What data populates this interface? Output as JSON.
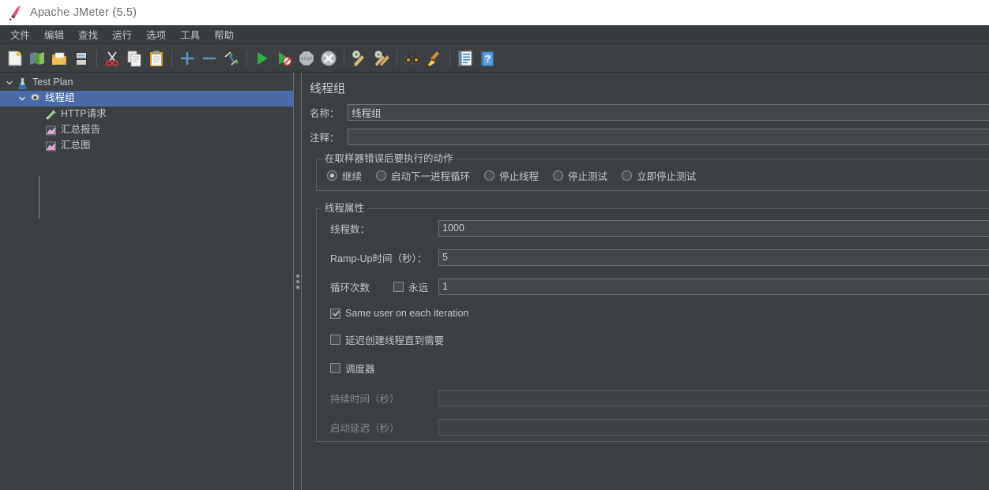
{
  "window": {
    "title": "Apache JMeter (5.5)",
    "logo_icon": "jmeter-feather-logo"
  },
  "menubar": {
    "items": [
      {
        "label": "文件",
        "name": "menu-file"
      },
      {
        "label": "编辑",
        "name": "menu-edit"
      },
      {
        "label": "查找",
        "name": "menu-search"
      },
      {
        "label": "运行",
        "name": "menu-run"
      },
      {
        "label": "选项",
        "name": "menu-options"
      },
      {
        "label": "工具",
        "name": "menu-tools"
      },
      {
        "label": "帮助",
        "name": "menu-help"
      }
    ]
  },
  "toolbar": {
    "buttons": [
      {
        "icon": "new-document-icon",
        "name": "new-test-plan-button"
      },
      {
        "icon": "templates-icon",
        "name": "templates-button"
      },
      {
        "icon": "open-folder-icon",
        "name": "open-button"
      },
      {
        "icon": "save-floppy-icon",
        "name": "save-button"
      },
      {
        "icon": "separator",
        "name": "toolbar-separator-1"
      },
      {
        "icon": "scissors-icon",
        "name": "cut-button"
      },
      {
        "icon": "copy-icon",
        "name": "copy-button"
      },
      {
        "icon": "paste-clipboard-icon",
        "name": "paste-button"
      },
      {
        "icon": "separator",
        "name": "toolbar-separator-2"
      },
      {
        "icon": "plus-icon",
        "name": "expand-all-button"
      },
      {
        "icon": "minus-icon",
        "name": "collapse-all-button"
      },
      {
        "icon": "toggle-icon",
        "name": "toggle-button"
      },
      {
        "icon": "separator",
        "name": "toolbar-separator-3"
      },
      {
        "icon": "play-green-icon",
        "name": "start-button"
      },
      {
        "icon": "play-no-timers-icon",
        "name": "start-no-pauses-button"
      },
      {
        "icon": "stop-sign-icon",
        "name": "stop-button"
      },
      {
        "icon": "shutdown-icon",
        "name": "shutdown-button"
      },
      {
        "icon": "separator",
        "name": "toolbar-separator-4"
      },
      {
        "icon": "clear-broom-icon",
        "name": "clear-button"
      },
      {
        "icon": "clear-all-broom-icon",
        "name": "clear-all-button"
      },
      {
        "icon": "separator",
        "name": "toolbar-separator-5"
      },
      {
        "icon": "binoculars-search-icon",
        "name": "search-button"
      },
      {
        "icon": "reset-search-broom-icon",
        "name": "reset-search-button"
      },
      {
        "icon": "separator",
        "name": "toolbar-separator-6"
      },
      {
        "icon": "function-helper-icon",
        "name": "function-helper-button"
      },
      {
        "icon": "help-book-icon",
        "name": "help-button"
      }
    ]
  },
  "tree": {
    "nodes": [
      {
        "label": "Test Plan",
        "icon": "test-plan-flask-icon",
        "expanded": true,
        "selected": false,
        "indent": 0,
        "name": "tree-node-test-plan"
      },
      {
        "label": "线程组",
        "icon": "thread-group-gear-icon",
        "expanded": true,
        "selected": true,
        "indent": 1,
        "name": "tree-node-thread-group"
      },
      {
        "label": "HTTP请求",
        "icon": "http-request-pipette-icon",
        "expanded": null,
        "selected": false,
        "indent": 2,
        "name": "tree-node-http-request"
      },
      {
        "label": "汇总报告",
        "icon": "summary-report-chart-icon",
        "expanded": null,
        "selected": false,
        "indent": 2,
        "name": "tree-node-summary-report"
      },
      {
        "label": "汇总图",
        "icon": "aggregate-graph-chart-icon",
        "expanded": null,
        "selected": false,
        "indent": 2,
        "name": "tree-node-aggregate-graph"
      }
    ]
  },
  "config": {
    "panel_title": "线程组",
    "name_label": "名称：",
    "name_value": "线程组",
    "comment_label": "注释：",
    "comment_value": "",
    "on_error": {
      "group_title": "在取样器错误后要执行的动作",
      "options": [
        {
          "label": "继续",
          "checked": true,
          "name": "radio-continue"
        },
        {
          "label": "启动下一进程循环",
          "checked": false,
          "name": "radio-start-next-loop"
        },
        {
          "label": "停止线程",
          "checked": false,
          "name": "radio-stop-thread"
        },
        {
          "label": "停止测试",
          "checked": false,
          "name": "radio-stop-test"
        },
        {
          "label": "立即停止测试",
          "checked": false,
          "name": "radio-stop-test-now"
        }
      ]
    },
    "thread_props": {
      "group_title": "线程属性",
      "num_threads_label": "线程数：",
      "num_threads_value": "1000",
      "rampup_label": "Ramp-Up时间（秒）：",
      "rampup_value": "5",
      "loops_label": "循环次数",
      "forever_label": "永远",
      "forever_checked": false,
      "loops_value": "1",
      "same_user_label": "Same user on each iteration",
      "same_user_checked": true,
      "delay_thread_label": "延迟创建线程直到需要",
      "delay_thread_checked": false,
      "scheduler_label": "调度器",
      "scheduler_checked": false,
      "duration_label": "持续时间（秒）",
      "duration_value": "",
      "startup_delay_label": "启动延迟（秒）",
      "startup_delay_value": ""
    }
  },
  "colors": {
    "window_bg": "#3c4043",
    "titlebar_bg": "#ffffff",
    "selection_blue": "#4a6ba8",
    "text_primary": "#c2c6c9",
    "text_dim": "#83888c",
    "input_bg": "#43474a",
    "border": "#6d7276"
  }
}
